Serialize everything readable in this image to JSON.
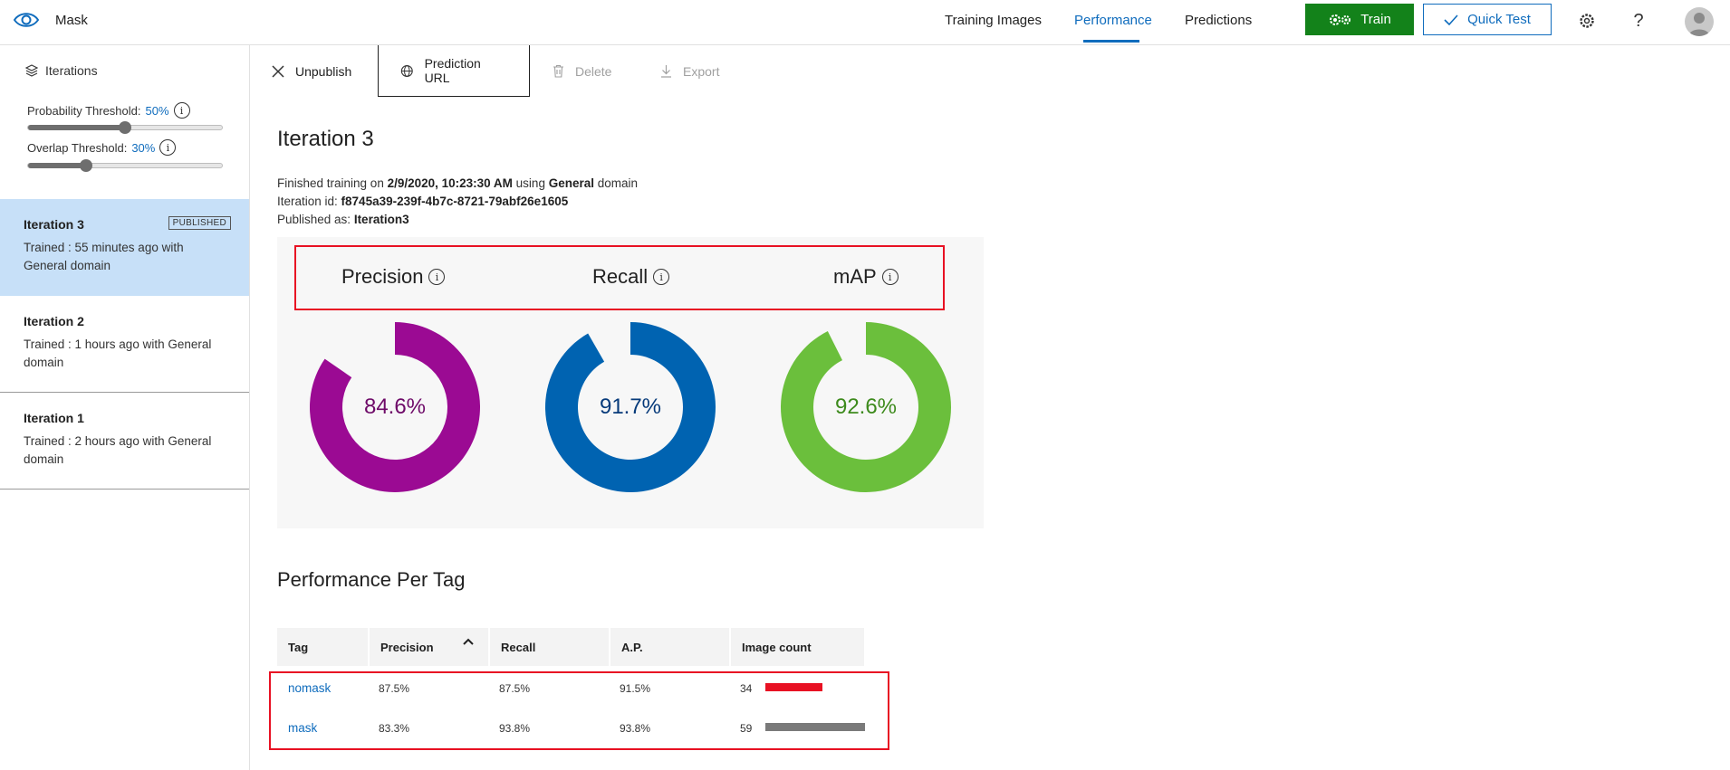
{
  "app": {
    "title": "Mask"
  },
  "nav": {
    "tabs": [
      {
        "label": "Training Images"
      },
      {
        "label": "Performance",
        "active": true
      },
      {
        "label": "Predictions"
      }
    ],
    "train_label": "Train",
    "quicktest_label": "Quick Test",
    "help_label": "?"
  },
  "sidebar": {
    "header": "Iterations",
    "probability": {
      "label": "Probability Threshold:",
      "value": "50%",
      "level": 0.5
    },
    "overlap": {
      "label": "Overlap Threshold:",
      "value": "30%",
      "level": 0.3
    },
    "iterations": [
      {
        "name": "Iteration 3",
        "desc": "Trained : 55 minutes ago with General domain",
        "badge": "PUBLISHED",
        "selected": true
      },
      {
        "name": "Iteration 2",
        "desc": "Trained : 1 hours ago with General domain"
      },
      {
        "name": "Iteration 1",
        "desc": "Trained : 2 hours ago with General domain"
      }
    ]
  },
  "toolbar": {
    "unpublish": "Unpublish",
    "prediction_url": "Prediction URL",
    "delete": "Delete",
    "export": "Export"
  },
  "main": {
    "title": "Iteration 3",
    "finished_prefix": "Finished training on ",
    "finished_date": "2/9/2020, 10:23:30 AM",
    "finished_mid": " using ",
    "finished_domain": "General",
    "finished_suffix": " domain",
    "iter_id_label": "Iteration id: ",
    "iter_id": "f8745a39-239f-4b7c-8721-79abf26e1605",
    "published_label": "Published as: ",
    "published_name": "Iteration3",
    "metrics": [
      {
        "label": "Precision",
        "value": "84.6%",
        "fraction": 0.846,
        "color": "#9b0a93",
        "text_color": "#6e0a68"
      },
      {
        "label": "Recall",
        "value": "91.7%",
        "fraction": 0.917,
        "color": "#0063b1",
        "text_color": "#063a7a"
      },
      {
        "label": "mAP",
        "value": "92.6%",
        "fraction": 0.926,
        "color": "#6bbf3c",
        "text_color": "#3d8a1c"
      }
    ],
    "per_tag_title": "Performance Per Tag",
    "table": {
      "headers": [
        "Tag",
        "Precision",
        "Recall",
        "A.P.",
        "Image count"
      ],
      "rows": [
        {
          "tag": "nomask",
          "precision": "87.5%",
          "recall": "87.5%",
          "ap": "91.5%",
          "count": "34",
          "count_value": 34,
          "bar_color": "#e81123"
        },
        {
          "tag": "mask",
          "precision": "83.3%",
          "recall": "93.8%",
          "ap": "93.8%",
          "count": "59",
          "count_value": 59,
          "bar_color": "#7a7a7a"
        }
      ]
    }
  },
  "colors": {
    "accent": "#0f6cbd",
    "train": "#13821a",
    "highlight": "#e81123"
  }
}
